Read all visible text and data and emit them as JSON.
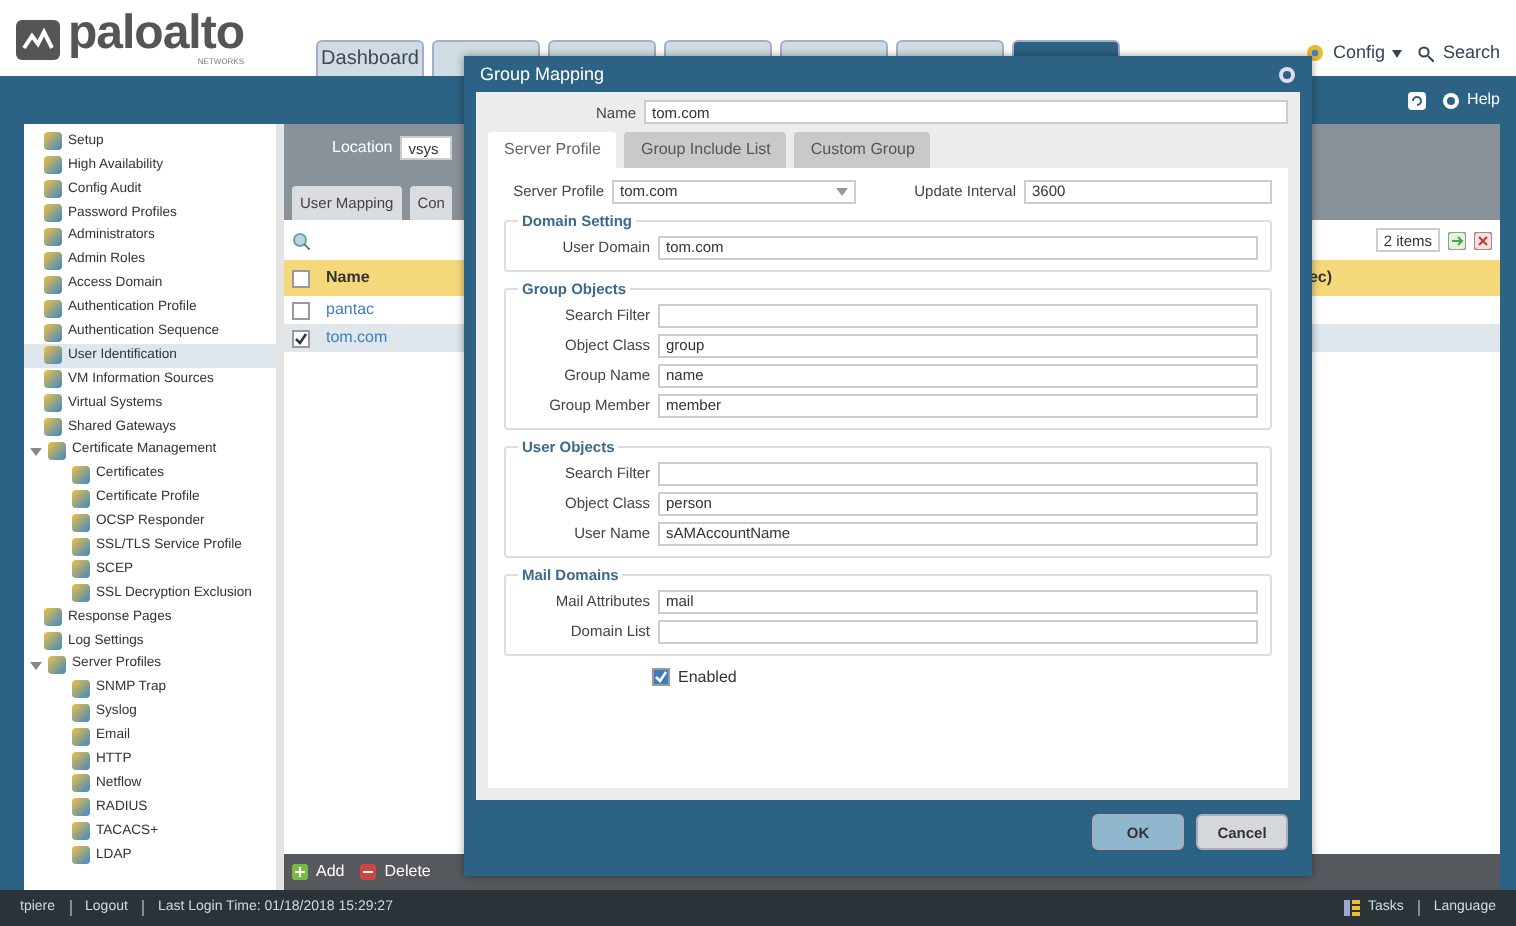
{
  "logo": {
    "name": "paloalto",
    "tagline": "NETWORKS"
  },
  "nav_tabs": [
    {
      "label": "Dashboard",
      "selected": false
    },
    {
      "selected": false
    },
    {
      "selected": false
    },
    {
      "selected": false
    },
    {
      "selected": false
    },
    {
      "selected": false
    },
    {
      "selected": true
    }
  ],
  "header_links": [
    {
      "kind": "dropdown",
      "label": "Config"
    },
    {
      "kind": "search",
      "label": "Search"
    }
  ],
  "toolbar": {
    "help": "Help"
  },
  "sidebar": {
    "items": [
      {
        "label": "Setup",
        "selected": false
      },
      {
        "label": "High Availability",
        "selected": false
      },
      {
        "label": "Config Audit",
        "selected": false
      },
      {
        "label": "Password Profiles",
        "selected": false
      },
      {
        "label": "Administrators",
        "selected": false
      },
      {
        "label": "Admin Roles",
        "selected": false
      },
      {
        "label": "Access Domain",
        "selected": false
      },
      {
        "label": "Authentication Profile",
        "selected": false
      },
      {
        "label": "Authentication Sequence",
        "selected": false
      },
      {
        "label": "User Identification",
        "selected": true
      },
      {
        "label": "VM Information Sources",
        "selected": false
      },
      {
        "label": "Virtual Systems",
        "selected": false
      },
      {
        "label": "Shared Gateways",
        "selected": false
      },
      {
        "label": "Certificate Management",
        "selected": false,
        "expanded": true,
        "children": [
          {
            "label": "Certificates",
            "selected": false
          },
          {
            "label": "Certificate Profile",
            "selected": false
          },
          {
            "label": "OCSP Responder",
            "selected": false
          },
          {
            "label": "SSL/TLS Service Profile",
            "selected": false
          },
          {
            "label": "SCEP",
            "selected": false
          },
          {
            "label": "SSL Decryption Exclusion",
            "selected": false
          }
        ]
      },
      {
        "label": "Response Pages",
        "selected": false
      },
      {
        "label": "Log Settings",
        "selected": false
      },
      {
        "label": "Server Profiles",
        "selected": false,
        "expanded": true,
        "children": [
          {
            "label": "SNMP Trap",
            "selected": false
          },
          {
            "label": "Syslog",
            "selected": false
          },
          {
            "label": "Email",
            "selected": false
          },
          {
            "label": "HTTP",
            "selected": false
          },
          {
            "label": "Netflow",
            "selected": false
          },
          {
            "label": "RADIUS",
            "selected": false
          },
          {
            "label": "TACACS+",
            "selected": false
          },
          {
            "label": "LDAP",
            "selected": false
          }
        ]
      }
    ]
  },
  "content": {
    "location_label": "Location",
    "location_value": "vsys",
    "tabs": [
      {
        "label": "User Mapping",
        "selected": false
      },
      {
        "label": "Con",
        "selected": false
      }
    ],
    "count": "2 items",
    "table": {
      "all_checked": false,
      "columns": [
        "Name",
        "ec)"
      ],
      "rows": [
        {
          "name": "pantac",
          "checked": false,
          "selected": false
        },
        {
          "name": "tom.com",
          "checked": true,
          "selected": true
        }
      ]
    },
    "actions": [
      {
        "kind": "add",
        "label": "Add"
      },
      {
        "kind": "delete",
        "label": "Delete"
      }
    ]
  },
  "dialog": {
    "title": "Group Mapping",
    "name_label": "Name",
    "name_value": "tom.com",
    "tabs": [
      {
        "label": "Server Profile",
        "selected": true
      },
      {
        "label": "Group Include List",
        "selected": false
      },
      {
        "label": "Custom Group",
        "selected": false
      }
    ],
    "server_profile": {
      "label": "Server Profile",
      "value": "tom.com"
    },
    "update_interval": {
      "label": "Update Interval",
      "value": "3600"
    },
    "sections": [
      {
        "title": "Domain Setting",
        "fields": [
          {
            "label": "User Domain",
            "value": "tom.com"
          }
        ]
      },
      {
        "title": "Group Objects",
        "fields": [
          {
            "label": "Search Filter"
          },
          {
            "label": "Object Class",
            "value": "group"
          },
          {
            "label": "Group Name",
            "value": "name"
          },
          {
            "label": "Group Member",
            "value": "member"
          }
        ]
      },
      {
        "title": "User Objects",
        "fields": [
          {
            "label": "Search Filter"
          },
          {
            "label": "Object Class",
            "value": "person"
          },
          {
            "label": "User Name",
            "value": "sAMAccountName"
          }
        ]
      },
      {
        "title": "Mail Domains",
        "fields": [
          {
            "label": "Mail Attributes",
            "value": "mail"
          },
          {
            "label": "Domain List"
          }
        ]
      }
    ],
    "enabled": {
      "label": "Enabled",
      "checked": true
    },
    "buttons": [
      {
        "kind": "primary",
        "label": "OK"
      },
      {
        "kind": "secondary",
        "label": "Cancel"
      }
    ]
  },
  "footer": {
    "left": [
      "tpiere",
      "Logout",
      "Last Login Time: 01/18/2018 15:29:27"
    ],
    "right": [
      "Tasks",
      "Language"
    ]
  }
}
